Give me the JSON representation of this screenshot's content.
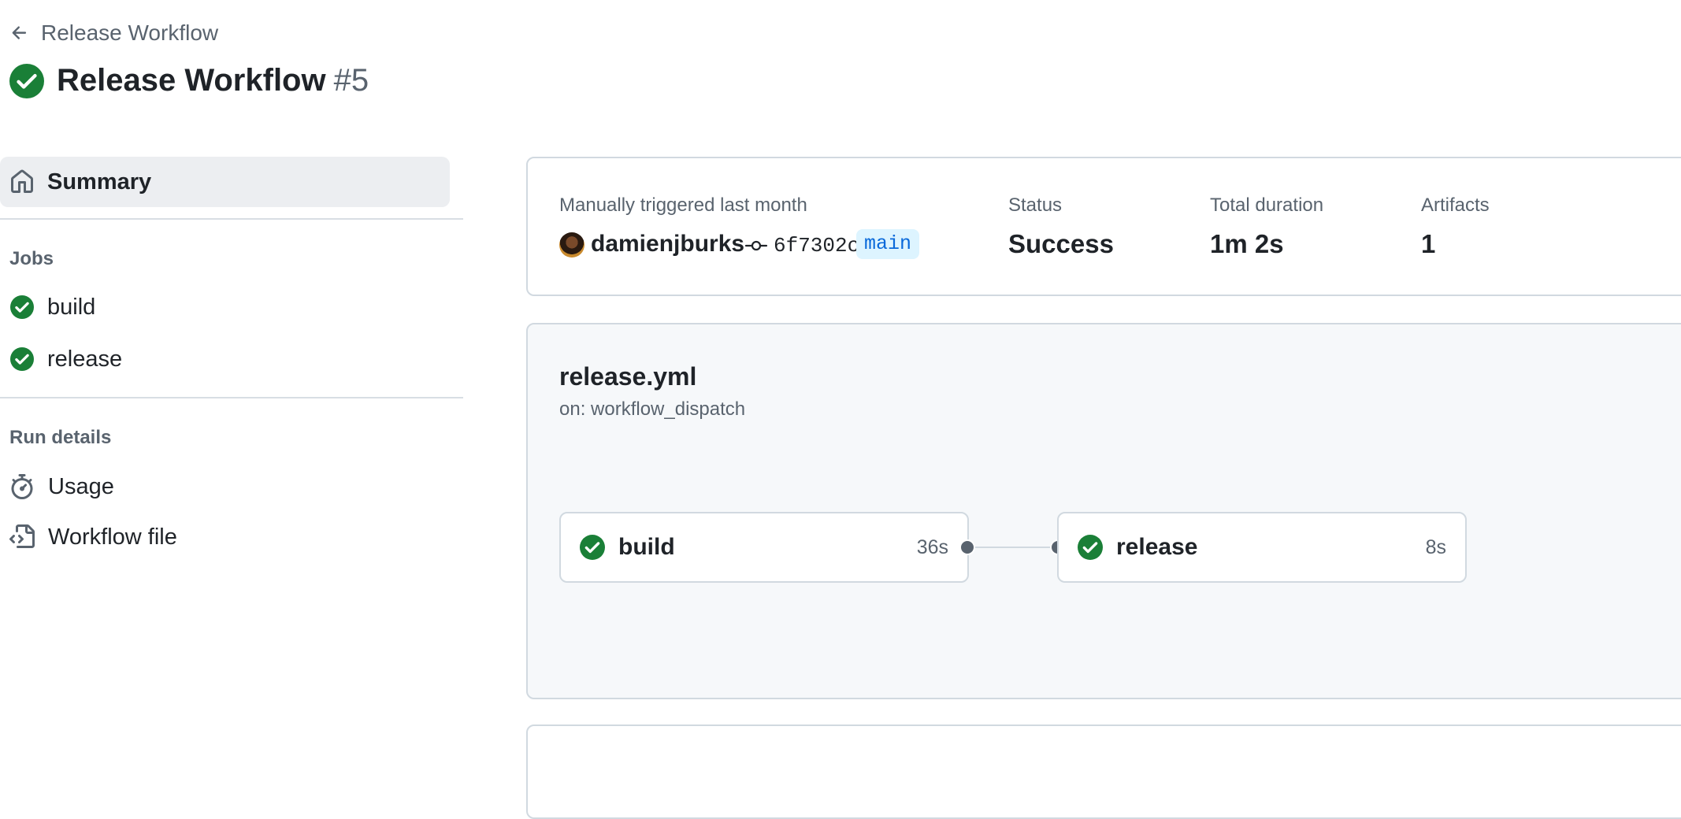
{
  "header": {
    "back_label": "Release Workflow",
    "title": "Release Workflow",
    "run_number": "#5"
  },
  "sidebar": {
    "summary_label": "Summary",
    "jobs_heading": "Jobs",
    "jobs": [
      {
        "label": "build",
        "status": "success"
      },
      {
        "label": "release",
        "status": "success"
      }
    ],
    "run_details_heading": "Run details",
    "run_details": [
      {
        "label": "Usage",
        "icon": "stopwatch-icon"
      },
      {
        "label": "Workflow file",
        "icon": "file-code-icon"
      }
    ]
  },
  "summary": {
    "trigger_text": "Manually triggered last month",
    "actor": "damienjburks",
    "commit_sha": "6f7302c",
    "branch": "main",
    "status_label": "Status",
    "status_value": "Success",
    "duration_label": "Total duration",
    "duration_value": "1m 2s",
    "artifacts_label": "Artifacts",
    "artifacts_value": "1"
  },
  "graph": {
    "file_name": "release.yml",
    "trigger": "on: workflow_dispatch",
    "jobs": [
      {
        "name": "build",
        "duration": "36s",
        "status": "success"
      },
      {
        "name": "release",
        "duration": "8s",
        "status": "success"
      }
    ]
  },
  "colors": {
    "success": "#1a7f37",
    "branch_bg": "#ddf4ff",
    "branch_fg": "#0969da",
    "muted": "#59636e"
  }
}
